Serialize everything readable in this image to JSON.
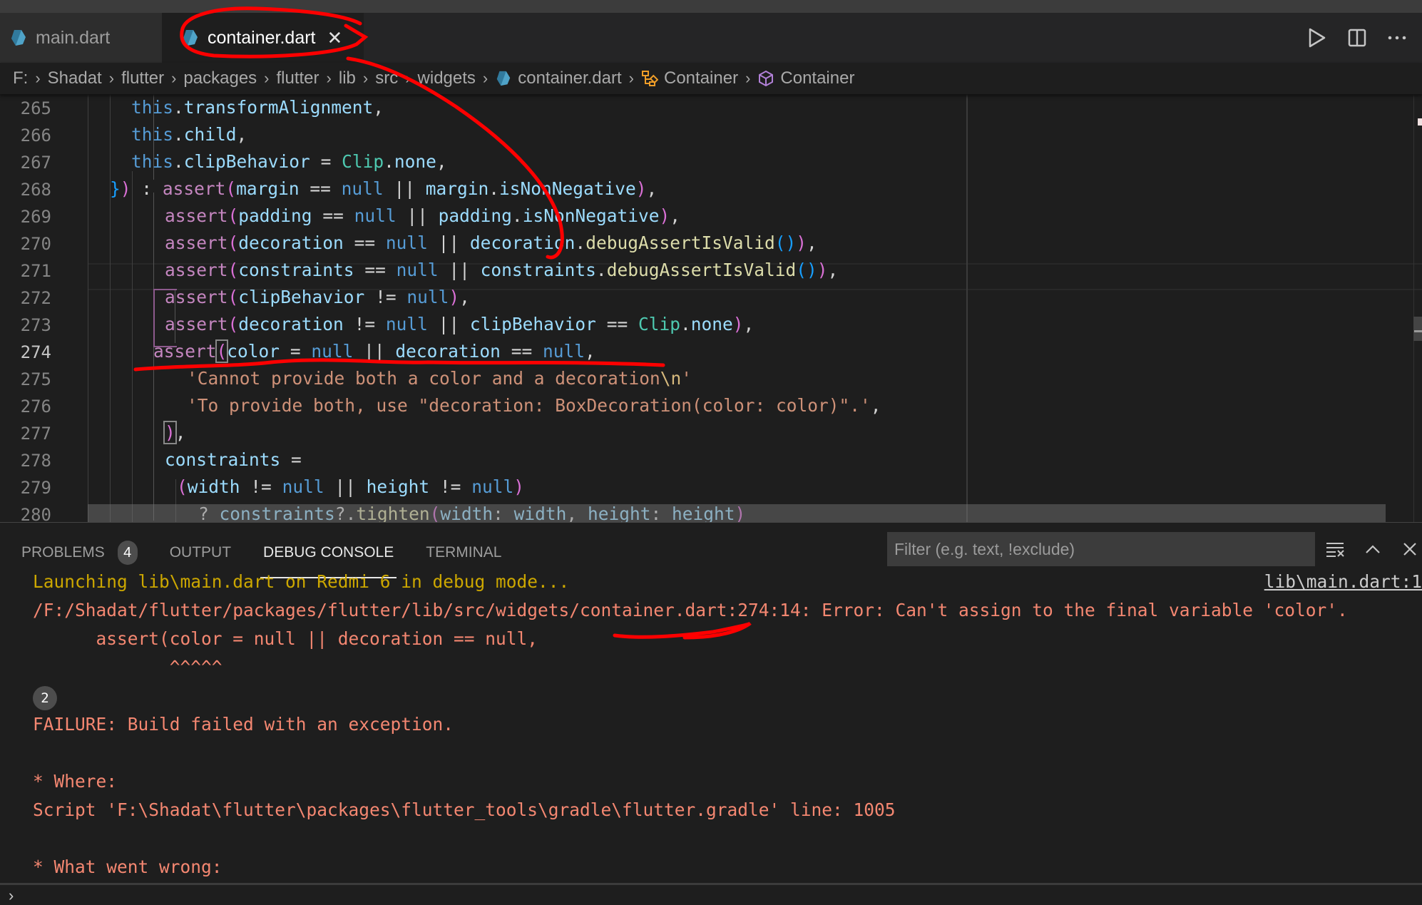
{
  "tabs": [
    {
      "label": "main.dart",
      "icon": "dart-file-icon",
      "active": false
    },
    {
      "label": "container.dart",
      "icon": "dart-file-icon",
      "active": true,
      "close": "✕"
    }
  ],
  "editor_actions": [
    {
      "name": "run-icon",
      "title": "Run"
    },
    {
      "name": "split-editor-icon",
      "title": "Split Editor"
    },
    {
      "name": "more-actions-icon",
      "title": "More Actions",
      "glyph": "···"
    }
  ],
  "breadcrumb": {
    "items": [
      "F:",
      "Shadat",
      "flutter",
      "packages",
      "flutter",
      "lib",
      "src",
      "widgets",
      "container.dart",
      "Container",
      "Container"
    ],
    "separator": "›"
  },
  "editor": {
    "current_line": 274,
    "line_numbers": [
      "265",
      "266",
      "267",
      "268",
      "269",
      "270",
      "271",
      "272",
      "273",
      "274",
      "275",
      "276",
      "277",
      "278",
      "279",
      "280"
    ],
    "lines": [
      "this.transformAlignment,",
      "this.child,",
      "this.clipBehavior = Clip.none,",
      "}) : assert(margin == null || margin.isNonNegative),",
      "assert(padding == null || padding.isNonNegative),",
      "assert(decoration == null || decoration.debugAssertIsValid()),",
      "assert(constraints == null || constraints.debugAssertIsValid()),",
      "assert(clipBehavior != null),",
      "assert(decoration != null || clipBehavior == Clip.none),",
      "assert(color = null || decoration == null,",
      "'Cannot provide both a color and a decoration\\n'",
      "'To provide both, use \"decoration: BoxDecoration(color: color)\".',",
      "),",
      "constraints =",
      "(width != null || height != null)",
      "? constraints?.tighten(width: width, height: height)"
    ]
  },
  "panel": {
    "tabs": [
      {
        "label": "PROBLEMS",
        "badge": "4",
        "active": false
      },
      {
        "label": "OUTPUT",
        "active": false
      },
      {
        "label": "DEBUG CONSOLE",
        "active": true
      },
      {
        "label": "TERMINAL",
        "active": false
      }
    ],
    "filter_placeholder": "Filter (e.g. text, !exclude)",
    "actions": [
      "clear-console-icon",
      "maximize-panel-icon",
      "close-panel-icon"
    ],
    "source_link": "lib\\main.dart:1",
    "console": {
      "launching": "Launching lib\\main.dart on Redmi 6 in debug mode...",
      "error_path": "/F:/Shadat/flutter/packages/flutter/lib/src/widgets/container.dart:274:14: Error: Can't assign to the final variable 'color'.",
      "error_code": "      assert(color = null || decoration == null,",
      "error_caret": "             ^^^^^",
      "repeat_count": "2",
      "failure": "FAILURE: Build failed with an exception.",
      "where_header": "* Where:",
      "where_detail": "Script 'F:\\Shadat\\flutter\\packages\\flutter_tools\\gradle\\flutter.gradle' line: 1005",
      "wrong_header": "* What went wrong:"
    },
    "prompt": "›"
  },
  "colors": {
    "accent_annotation": "#ff0000",
    "console_info": "#cca700",
    "console_error": "#f48771",
    "dart_blue": "#4fa3c8"
  }
}
